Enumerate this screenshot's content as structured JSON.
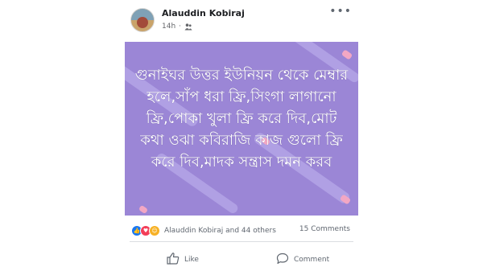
{
  "post": {
    "author": "Alauddin Kobiraj",
    "time": "14h",
    "image_text": "গুনাইঘর উত্তর ইউনিয়ন থেকে মেম্বার হলে,সাঁপ ধরা ফ্রি,সিংগা লাগানো ফ্রি,পোকা খুলা ফ্রি করে দিব,মোট কথা ওঝা কবিরাজি কাজ গুলো ফ্রি করে দিব,মাদক সন্ত্রাস দমন করব",
    "image_background": "#9b86d6"
  },
  "reactions": {
    "summary": "Alauddin Kobiraj and 44 others",
    "comments": "15 Comments",
    "types": [
      "like",
      "love",
      "haha"
    ]
  },
  "actions": {
    "like_label": "Like",
    "comment_label": "Comment"
  },
  "colors": {
    "like_blue": "#1877f2",
    "love_red": "#f33e58",
    "haha_yellow": "#f7b125"
  }
}
